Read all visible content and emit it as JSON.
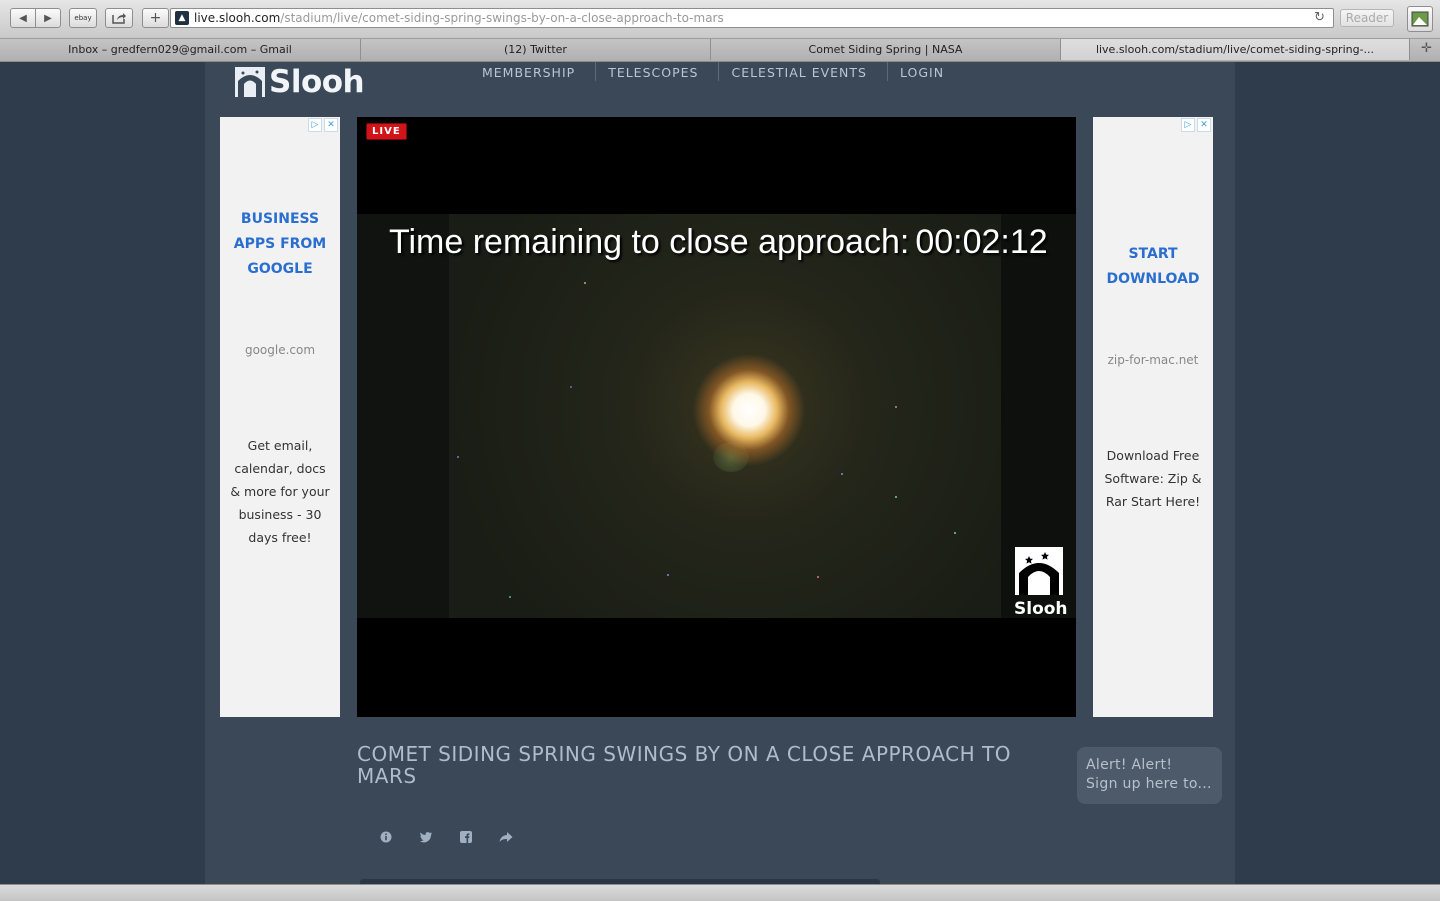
{
  "browser": {
    "url_domain": "live.slooh.com",
    "url_path": "/stadium/live/comet-siding-spring-swings-by-on-a-close-approach-to-mars",
    "ebay_label": "ebay",
    "reader_label": "Reader",
    "tabs": [
      {
        "label": "Inbox – gredfern029@gmail.com – Gmail"
      },
      {
        "label": "(12) Twitter"
      },
      {
        "label": "Comet Siding Spring | NASA"
      },
      {
        "label": "live.slooh.com/stadium/live/comet-siding-spring-..."
      }
    ]
  },
  "site": {
    "logo_text": "Slooh",
    "nav": [
      "MEMBERSHIP",
      "TELESCOPES",
      "CELESTIAL EVENTS",
      "LOGIN"
    ]
  },
  "ads": {
    "left": {
      "headline": [
        "BUSINESS",
        "APPS FROM",
        "GOOGLE"
      ],
      "domain": "google.com",
      "description": "Get email, calendar, docs & more for your business - 30 days free!"
    },
    "right": {
      "headline": [
        "START",
        "DOWNLOAD"
      ],
      "domain": "zip-for-mac.net",
      "description": "Download Free Software: Zip & Rar Start Here!"
    }
  },
  "video": {
    "live_badge": "LIVE",
    "countdown_label": "Time remaining to close approach:",
    "countdown_time": "00:02:12",
    "watermark": "Slooh"
  },
  "event": {
    "title": "COMET SIDING SPRING SWINGS BY ON A CLOSE APPROACH TO MARS",
    "alert_line1": "Alert! Alert!",
    "alert_line2": "Sign up here to..."
  },
  "colors": {
    "page_bg": "#2e3c4c",
    "content_bg": "#3a4858",
    "live_red": "#d0141a",
    "ad_link_blue": "#2a6fcf"
  }
}
